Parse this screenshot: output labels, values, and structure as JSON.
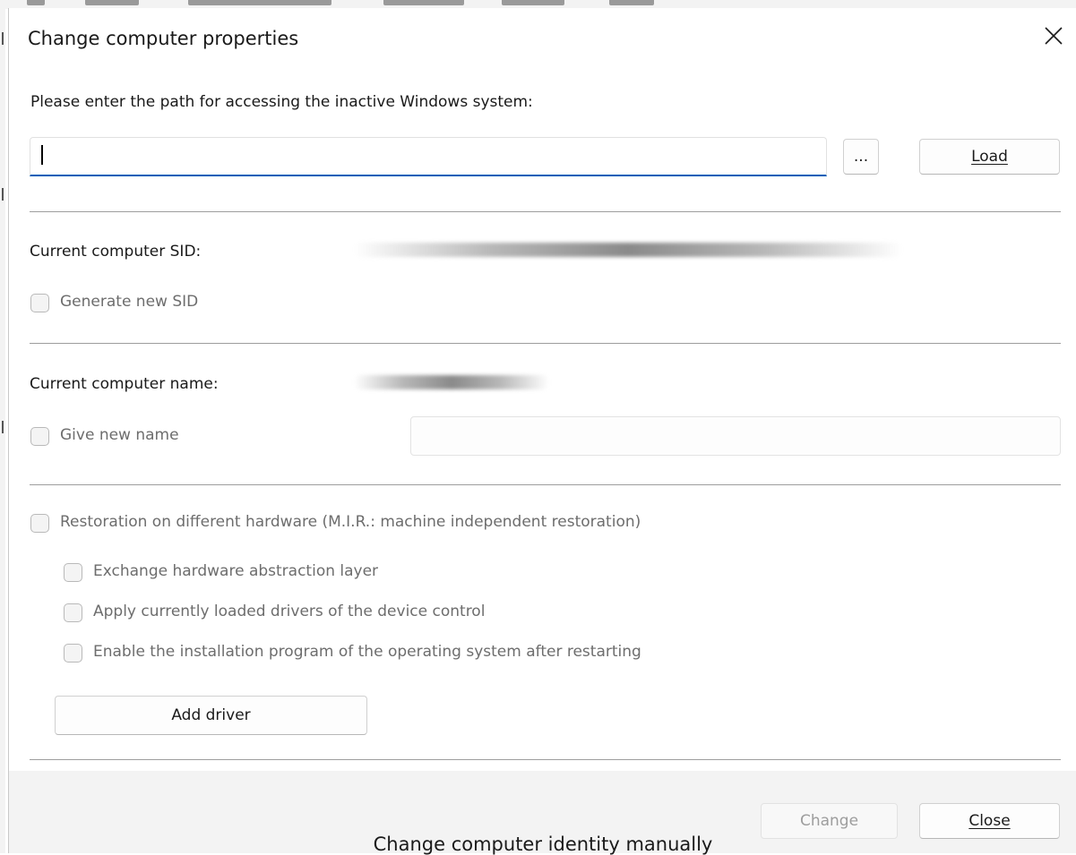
{
  "dialog": {
    "title": "Change computer properties",
    "close_icon": "close-icon"
  },
  "path_section": {
    "prompt": "Please enter the path for accessing the inactive Windows system:",
    "path_value": "",
    "browse_label": "...",
    "load_label": "Load"
  },
  "sid_section": {
    "label": "Current computer SID:",
    "generate_label": "Generate new SID",
    "generate_checked": false
  },
  "name_section": {
    "label": "Current computer name:",
    "give_label": "Give new name",
    "give_checked": false,
    "new_name_value": ""
  },
  "mir_section": {
    "restoration_label": "Restoration on different hardware (M.I.R.: machine independent restoration)",
    "options": [
      {
        "label": "Exchange hardware abstraction layer",
        "checked": false
      },
      {
        "label": "Apply currently loaded drivers of the device control",
        "checked": false
      },
      {
        "label": "Enable the installation program of the operating system after restarting",
        "checked": false
      }
    ],
    "add_driver_label": "Add driver"
  },
  "footer": {
    "change_label": "Change",
    "close_label": "Close"
  },
  "caption": "Change computer identity manually"
}
